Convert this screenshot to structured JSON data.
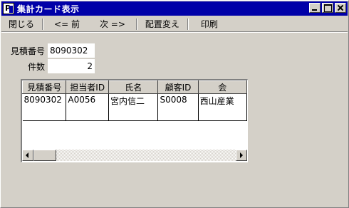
{
  "window": {
    "title": "集計カード表示",
    "icon": "app-icon"
  },
  "menu": {
    "items": [
      {
        "label": "閉じる"
      },
      {
        "label": "<= 前"
      },
      {
        "label": "次 =>"
      },
      {
        "label": "配置変え"
      },
      {
        "label": "印刷"
      }
    ]
  },
  "form": {
    "estimate_label": "見積番号",
    "estimate_value": "8090302",
    "count_label": "件数",
    "count_value": "2"
  },
  "grid": {
    "columns": [
      "見積番号",
      "担当者ID",
      "氏名",
      "顧客ID",
      "会"
    ],
    "rows": [
      [
        "8090302",
        "A0056",
        "宮内信二",
        "S0008",
        "西山産業"
      ]
    ]
  }
}
